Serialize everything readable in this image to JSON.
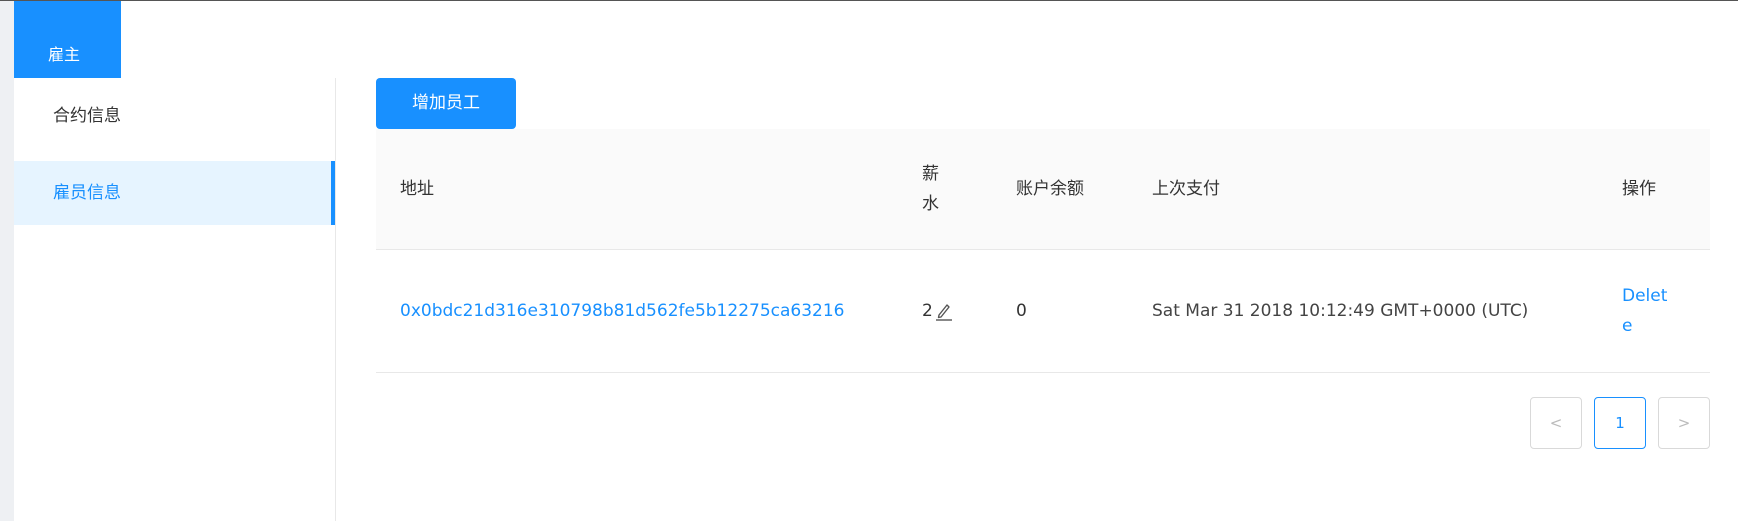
{
  "header": {
    "role_tab_label": "雇主"
  },
  "sidebar": {
    "items": [
      {
        "label": "合约信息"
      },
      {
        "label": "雇员信息"
      }
    ]
  },
  "toolbar": {
    "add_employee_label": "增加员工"
  },
  "table": {
    "columns": [
      "地址",
      "薪水",
      "账户余额",
      "上次支付",
      "操作"
    ],
    "rows": [
      {
        "address": "0x0bdc21d316e310798b81d562fe5b12275ca63216",
        "salary": "2",
        "balance": "0",
        "last_payment": "Sat Mar 31 2018 10:12:49 GMT+0000 (UTC)",
        "action": "Delete"
      }
    ]
  },
  "pagination": {
    "prev_symbol": "<",
    "current_page": "1",
    "next_symbol": ">"
  },
  "colors": {
    "accent": "#1890ff",
    "selected_bg": "#e6f4ff",
    "header_bg": "#fafafa"
  },
  "icons": {
    "edit": "pencil-icon"
  }
}
